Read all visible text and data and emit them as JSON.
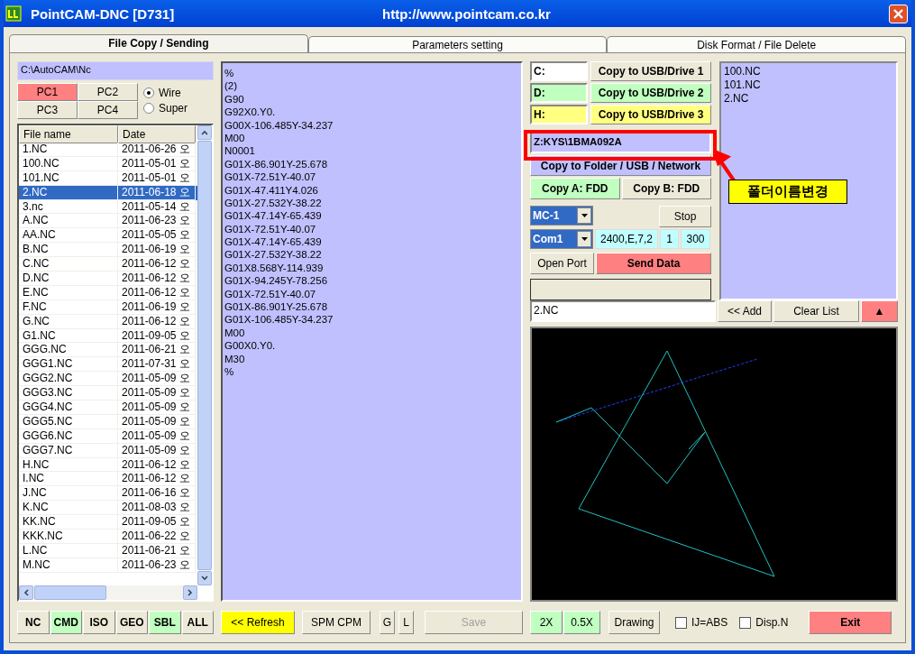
{
  "window": {
    "title": "PointCAM-DNC  [D731]",
    "url": "http://www.pointcam.co.kr"
  },
  "tabs": [
    {
      "label": "File Copy / Sending",
      "selected": true
    },
    {
      "label": "Parameters setting",
      "selected": false
    },
    {
      "label": "Disk Format / File Delete",
      "selected": false
    }
  ],
  "folder_path": "C:\\AutoCAM\\Nc",
  "pc_buttons": [
    {
      "label": "PC1",
      "selected": true
    },
    {
      "label": "PC2",
      "selected": false
    },
    {
      "label": "PC3",
      "selected": false
    },
    {
      "label": "PC4",
      "selected": false
    }
  ],
  "modes": [
    {
      "label": "Wire",
      "selected": true
    },
    {
      "label": "Super",
      "selected": false
    }
  ],
  "file_list": {
    "columns": [
      "File name",
      "Date"
    ],
    "rows": [
      {
        "name": "1.NC",
        "date": "2011-06-26 오",
        "selected": false
      },
      {
        "name": "100.NC",
        "date": "2011-05-01 오",
        "selected": false
      },
      {
        "name": "101.NC",
        "date": "2011-05-01 오",
        "selected": false
      },
      {
        "name": "2.NC",
        "date": "2011-06-18 오",
        "selected": true
      },
      {
        "name": "3.nc",
        "date": "2011-05-14 오",
        "selected": false
      },
      {
        "name": "A.NC",
        "date": "2011-06-23 오",
        "selected": false
      },
      {
        "name": "AA.NC",
        "date": "2011-05-05 오",
        "selected": false
      },
      {
        "name": "B.NC",
        "date": "2011-06-19 오",
        "selected": false
      },
      {
        "name": "C.NC",
        "date": "2011-06-12 오",
        "selected": false
      },
      {
        "name": "D.NC",
        "date": "2011-06-12 오",
        "selected": false
      },
      {
        "name": "E.NC",
        "date": "2011-06-12 오",
        "selected": false
      },
      {
        "name": "F.NC",
        "date": "2011-06-19 오",
        "selected": false
      },
      {
        "name": "G.NC",
        "date": "2011-06-12 오",
        "selected": false
      },
      {
        "name": "G1.NC",
        "date": "2011-09-05 오",
        "selected": false
      },
      {
        "name": "GGG.NC",
        "date": "2011-06-21 오",
        "selected": false
      },
      {
        "name": "GGG1.NC",
        "date": "2011-07-31 오",
        "selected": false
      },
      {
        "name": "GGG2.NC",
        "date": "2011-05-09 오",
        "selected": false
      },
      {
        "name": "GGG3.NC",
        "date": "2011-05-09 오",
        "selected": false
      },
      {
        "name": "GGG4.NC",
        "date": "2011-05-09 오",
        "selected": false
      },
      {
        "name": "GGG5.NC",
        "date": "2011-05-09 오",
        "selected": false
      },
      {
        "name": "GGG6.NC",
        "date": "2011-05-09 오",
        "selected": false
      },
      {
        "name": "GGG7.NC",
        "date": "2011-05-09 오",
        "selected": false
      },
      {
        "name": "H.NC",
        "date": "2011-06-12 오",
        "selected": false
      },
      {
        "name": "I.NC",
        "date": "2011-06-12 오",
        "selected": false
      },
      {
        "name": "J.NC",
        "date": "2011-06-16 오",
        "selected": false
      },
      {
        "name": "K.NC",
        "date": "2011-08-03 오",
        "selected": false
      },
      {
        "name": "KK.NC",
        "date": "2011-09-05 오",
        "selected": false
      },
      {
        "name": "KKK.NC",
        "date": "2011-06-22 오",
        "selected": false
      },
      {
        "name": "L.NC",
        "date": "2011-06-21 오",
        "selected": false
      },
      {
        "name": "M.NC",
        "date": "2011-06-23 오",
        "selected": false
      }
    ]
  },
  "code_lines": [
    "%",
    "(2)",
    "G90",
    "G92X0.Y0.",
    "G00X-106.485Y-34.237",
    "M00",
    "N0001",
    "G01X-86.901Y-25.678",
    "G01X-72.51Y-40.07",
    "G01X-47.411Y4.026",
    "G01X-27.532Y-38.22",
    "G01X-47.14Y-65.439",
    "G01X-72.51Y-40.07",
    "G01X-47.14Y-65.439",
    "G01X-27.532Y-38.22",
    "G01X8.568Y-114.939",
    "G01X-94.245Y-78.256",
    "G01X-72.51Y-40.07",
    "G01X-86.901Y-25.678",
    "G01X-106.485Y-34.237",
    "M00",
    "G00X0.Y0.",
    "M30",
    "%"
  ],
  "drives": [
    {
      "letter": "C:",
      "button": "Copy to USB/Drive 1",
      "color": "#ffffff"
    },
    {
      "letter": "D:",
      "button": "Copy to USB/Drive 2",
      "color": "#c0ffc0"
    },
    {
      "letter": "H:",
      "button": "Copy to USB/Drive 3",
      "color": "#ffff80"
    }
  ],
  "target_path": "Z:KYS\\1BMA092A",
  "copy_folder_button": "Copy to Folder / USB / Network",
  "fdd_buttons": [
    {
      "label": "Copy A: FDD",
      "color": "#c0ffc0"
    },
    {
      "label": "Copy B: FDD",
      "color": "#ece9d8"
    }
  ],
  "machine_select": "MC-1",
  "stop_button": "Stop",
  "port_select": "Com1",
  "port_settings": [
    "2400,E,7,2",
    "1",
    "300"
  ],
  "open_port_button": "Open Port",
  "send_button": "Send Data",
  "queue": [
    "100.NC",
    "101.NC",
    "2.NC"
  ],
  "queue_input": "2.NC",
  "add_button": "<< Add",
  "clear_button": "Clear List",
  "up_button": "▲",
  "annotation": "폴더이름변경",
  "filter_buttons": [
    {
      "label": "NC",
      "active": false
    },
    {
      "label": "CMD",
      "active": true
    },
    {
      "label": "ISO",
      "active": false
    },
    {
      "label": "GEO",
      "active": false
    },
    {
      "label": "SBL",
      "active": true
    },
    {
      "label": "ALL",
      "active": false
    }
  ],
  "refresh_button": "<< Refresh",
  "spm_button": "SPM CPM",
  "g_button": "G",
  "l_button": "L",
  "save_button": {
    "label": "Save",
    "disabled": true
  },
  "zoom_buttons": [
    "2X",
    "0.5X"
  ],
  "drawing_button": "Drawing",
  "checkboxes": [
    {
      "label": "IJ=ABS",
      "checked": false
    },
    {
      "label": "Disp.N",
      "checked": false
    }
  ],
  "exit_button": "Exit"
}
